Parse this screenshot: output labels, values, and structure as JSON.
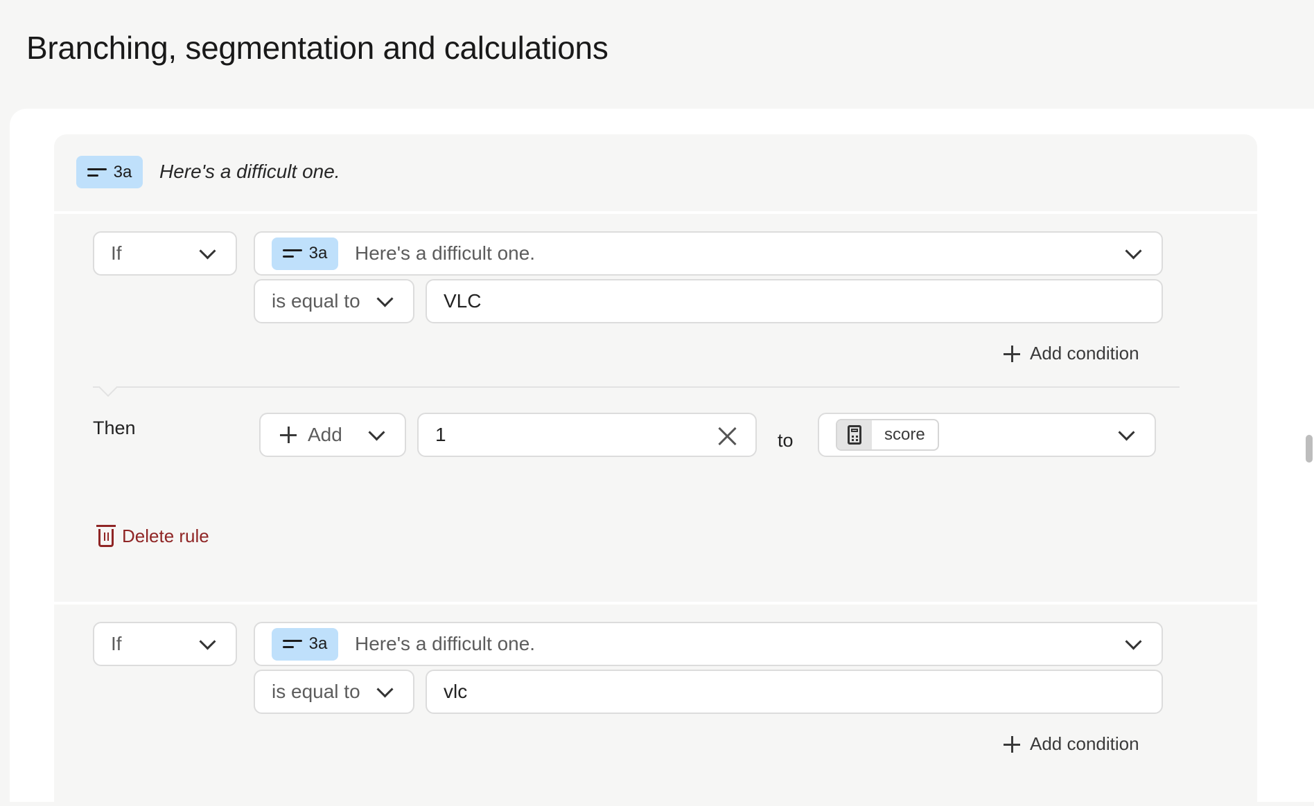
{
  "page": {
    "title": "Branching, segmentation and calculations"
  },
  "question": {
    "badge": "3a",
    "text": "Here's a difficult one.",
    "badge_color": "#bfe0fb"
  },
  "rules": [
    {
      "condition_keyword": "If",
      "question_badge": "3a",
      "question_text": "Here's a difficult one.",
      "operator": "is equal to",
      "value": "VLC",
      "add_condition_label": "Add condition",
      "then_label": "Then",
      "action": "Add",
      "amount": "1",
      "to_label": "to",
      "variable": "score",
      "delete_label": "Delete rule"
    },
    {
      "condition_keyword": "If",
      "question_badge": "3a",
      "question_text": "Here's a difficult one.",
      "operator": "is equal to",
      "value": "vlc",
      "add_condition_label": "Add condition"
    }
  ],
  "icons": {
    "question_type": "short-text-icon",
    "dropdown": "chevron-down-icon",
    "add": "plus-icon",
    "clear": "close-icon",
    "variable": "calculator-icon",
    "delete": "trash-icon"
  },
  "colors": {
    "delete": "#8f2525",
    "panel_bg": "#f6f6f5"
  }
}
